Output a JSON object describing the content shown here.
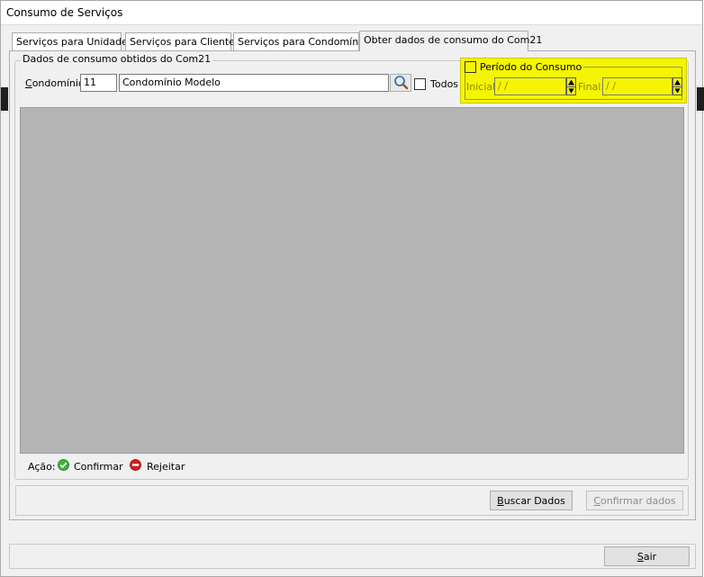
{
  "window": {
    "title": "Consumo de Serviços"
  },
  "tabs": [
    {
      "label": "Serviços para Unidades"
    },
    {
      "label": "Serviços para Clientes"
    },
    {
      "label": "Serviços para Condomínios"
    },
    {
      "label": "Obter dados de consumo do Com21"
    }
  ],
  "active_tab": 3,
  "group": {
    "title": "Dados de consumo obtidos do Com21"
  },
  "condominio": {
    "label_underlined": "C",
    "label_rest": "ondomínio:",
    "code": "11",
    "name": "Condomínio Modelo",
    "search_icon": "magnifier-icon"
  },
  "todos": {
    "label": "Todos",
    "checked": false
  },
  "period": {
    "title": "Período do Consumo",
    "checked": false,
    "highlight_color": "#f5f500",
    "initial_label": "Inicial:",
    "initial_value": " / /",
    "final_label": "Final:",
    "final_value": " / /"
  },
  "legend": {
    "label": "Ação:",
    "confirm": {
      "label": "Confirmar",
      "icon": "check-circle-icon",
      "color": "#3cb43c"
    },
    "reject": {
      "label": "Rejeitar",
      "icon": "minus-circle-icon",
      "color": "#d62020"
    }
  },
  "buttons": {
    "buscar": {
      "u": "B",
      "rest": "uscar Dados"
    },
    "confirmar": {
      "u": "C",
      "rest": "onfirmar dados",
      "disabled": true
    },
    "sair": {
      "u": "S",
      "rest": "air"
    }
  }
}
